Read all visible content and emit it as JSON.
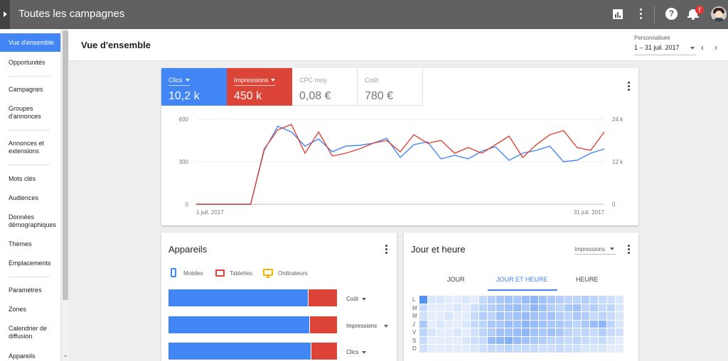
{
  "topbar": {
    "title": "Toutes les campagnes",
    "notification_count": "!"
  },
  "sidebar": {
    "items": [
      {
        "label": "Vue d'ensemble"
      },
      {
        "label": "Opportunités"
      },
      {
        "label": "Campagnes"
      },
      {
        "label": "Groupes d'annonces"
      },
      {
        "label": "Annonces et extensions"
      },
      {
        "label": "Mots clés"
      },
      {
        "label": "Audiences"
      },
      {
        "label": "Données démographiques"
      },
      {
        "label": "Thèmes"
      },
      {
        "label": "Emplacements"
      },
      {
        "label": "Paramètres"
      },
      {
        "label": "Zones"
      },
      {
        "label": "Calendrier de diffusion"
      },
      {
        "label": "Appareils"
      }
    ]
  },
  "header": {
    "title": "Vue d'ensemble",
    "date_label": "Personnalisée",
    "date_range": "1 – 31 juil. 2017"
  },
  "metrics": {
    "clics": {
      "label": "Clics",
      "value": "10,2 k"
    },
    "impressions": {
      "label": "Impressions",
      "value": "450 k"
    },
    "cpc": {
      "label": "CPC moy.",
      "value": "0,08 €"
    },
    "cout": {
      "label": "Coût",
      "value": "780 €"
    }
  },
  "colors": {
    "blue": "#4285f4",
    "red": "#db4437",
    "yellow": "#f4b400"
  },
  "chart_data": {
    "type": "line",
    "x_start_label": "1 juil. 2017",
    "x_end_label": "31 juil. 2017",
    "left_axis": {
      "ylim": [
        0,
        600
      ],
      "ticks": [
        "0",
        "300",
        "600"
      ]
    },
    "right_axis": {
      "ylim": [
        0,
        24000
      ],
      "ticks": [
        "0",
        "12 k",
        "24 k"
      ]
    },
    "grid": true,
    "series": [
      {
        "name": "Clics",
        "axis": "left",
        "values": [
          0,
          0,
          0,
          0,
          0,
          380,
          550,
          510,
          410,
          460,
          370,
          410,
          415,
          430,
          465,
          330,
          420,
          440,
          320,
          345,
          320,
          375,
          405,
          310,
          360,
          380,
          410,
          300,
          310,
          360,
          390
        ]
      },
      {
        "name": "Impressions",
        "axis": "right",
        "values": [
          0,
          0,
          0,
          0,
          0,
          15600,
          21000,
          22500,
          14400,
          20400,
          13600,
          14400,
          15600,
          17200,
          18000,
          14800,
          19600,
          17200,
          18000,
          14400,
          16000,
          14400,
          16800,
          19200,
          13200,
          16800,
          19600,
          20800,
          16000,
          15200,
          20400
        ]
      }
    ]
  },
  "devices": {
    "title": "Appareils",
    "legend": [
      "Mobiles",
      "Tablettes",
      "Ordinateurs"
    ],
    "rows": [
      {
        "metric": "Coût",
        "mobile_share": 0.83
      },
      {
        "metric": "Impressions",
        "mobile_share": 0.84
      },
      {
        "metric": "Clics",
        "mobile_share": 0.85
      }
    ]
  },
  "dayhour": {
    "title": "Jour et heure",
    "metric": "Impressions",
    "tabs": [
      "JOUR",
      "JOUR ET HEURE",
      "HEURE"
    ],
    "active_tab": "JOUR ET HEURE",
    "days": [
      "L",
      "M",
      "M",
      "J",
      "V",
      "S",
      "D"
    ],
    "heatmap": [
      [
        0.9,
        0.2,
        0.2,
        0.15,
        0.15,
        0.2,
        0.15,
        0.3,
        0.4,
        0.45,
        0.5,
        0.45,
        0.55,
        0.6,
        0.5,
        0.45,
        0.4,
        0.35,
        0.35,
        0.4,
        0.35,
        0.3,
        0.25,
        0.2
      ],
      [
        0.3,
        0.15,
        0.15,
        0.15,
        0.2,
        0.15,
        0.25,
        0.35,
        0.4,
        0.45,
        0.5,
        0.55,
        0.45,
        0.6,
        0.5,
        0.4,
        0.35,
        0.45,
        0.5,
        0.35,
        0.4,
        0.3,
        0.35,
        0.2
      ],
      [
        0.25,
        0.15,
        0.15,
        0.2,
        0.15,
        0.15,
        0.3,
        0.4,
        0.35,
        0.5,
        0.45,
        0.5,
        0.55,
        0.5,
        0.45,
        0.5,
        0.4,
        0.35,
        0.45,
        0.4,
        0.3,
        0.35,
        0.3,
        0.2
      ],
      [
        0.45,
        0.15,
        0.2,
        0.15,
        0.15,
        0.2,
        0.3,
        0.35,
        0.45,
        0.45,
        0.55,
        0.5,
        0.6,
        0.55,
        0.5,
        0.45,
        0.45,
        0.4,
        0.35,
        0.45,
        0.55,
        0.6,
        0.35,
        0.2
      ],
      [
        0.35,
        0.2,
        0.15,
        0.15,
        0.2,
        0.15,
        0.25,
        0.35,
        0.4,
        0.5,
        0.5,
        0.55,
        0.6,
        0.5,
        0.45,
        0.5,
        0.45,
        0.35,
        0.3,
        0.35,
        0.3,
        0.4,
        0.3,
        0.25
      ],
      [
        0.3,
        0.15,
        0.15,
        0.15,
        0.15,
        0.2,
        0.25,
        0.3,
        0.55,
        0.6,
        0.65,
        0.55,
        0.5,
        0.45,
        0.4,
        0.35,
        0.35,
        0.3,
        0.35,
        0.3,
        0.25,
        0.3,
        0.2,
        0.15
      ],
      [
        0.25,
        0.15,
        0.15,
        0.15,
        0.15,
        0.15,
        0.2,
        0.25,
        0.3,
        0.3,
        0.35,
        0.3,
        0.3,
        0.3,
        0.25,
        0.25,
        0.3,
        0.25,
        0.25,
        0.2,
        0.2,
        0.2,
        0.15,
        0.15
      ]
    ]
  }
}
